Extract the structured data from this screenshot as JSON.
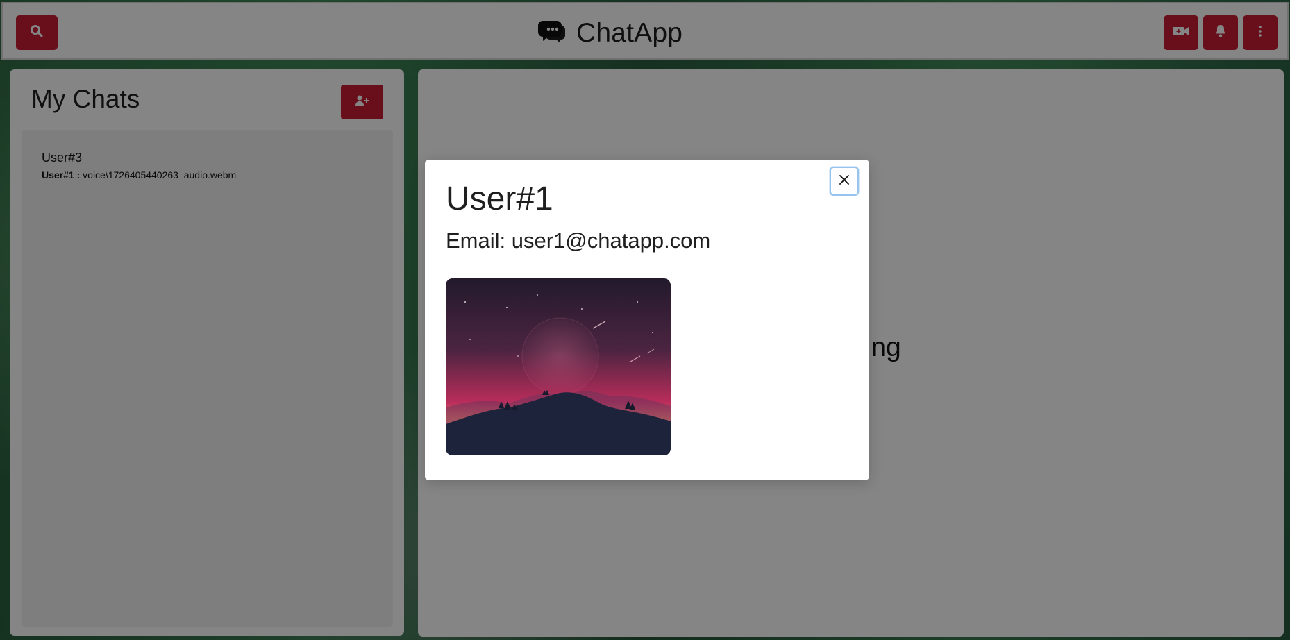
{
  "app": {
    "title": "ChatApp"
  },
  "header": {
    "icons": {
      "search": "search-icon",
      "chat_logo": "chat-bubble-icon",
      "video": "video-call-icon",
      "notifications": "bell-icon",
      "more": "more-vertical-icon"
    }
  },
  "sidebar": {
    "title": "My Chats",
    "add_icon": "add-user-icon",
    "chats": [
      {
        "name": "User#3",
        "sender": "User#1 :",
        "preview": " voice\\1726405440263_audio.webm"
      }
    ]
  },
  "main": {
    "empty_state": "o start chatting"
  },
  "modal": {
    "title": "User#1",
    "email_label": "Email: user1@chatapp.com",
    "close_icon": "close-icon",
    "image_name": "profile-image"
  },
  "colors": {
    "accent": "#c81e35",
    "overlay": "#000000",
    "modal_border": "#97c4ef"
  }
}
